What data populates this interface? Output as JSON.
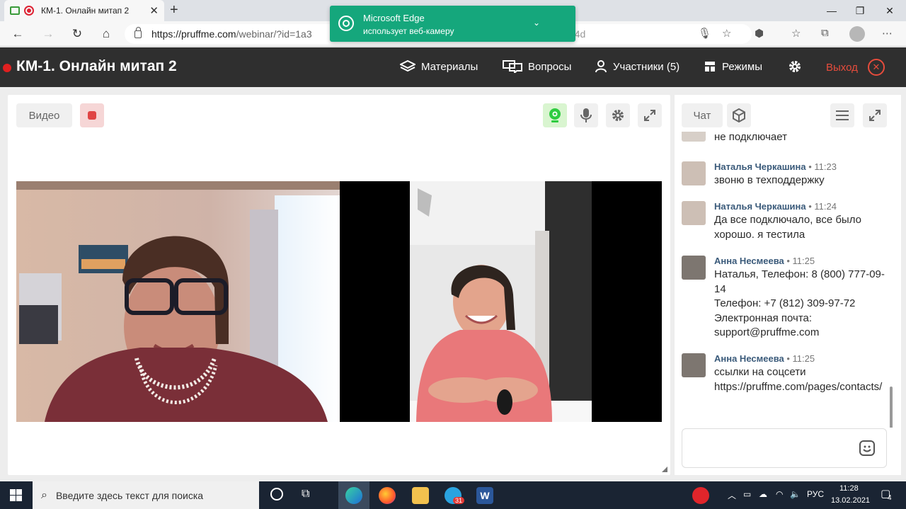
{
  "browser": {
    "tab_title": "КМ-1. Онлайн митап 2",
    "url_host": "https://pruffme.com",
    "url_rest": "/webinar/?id=1a3",
    "url_tail": "b7764d"
  },
  "notification": {
    "title": "Microsoft Edge",
    "text": "использует веб-камеру"
  },
  "header": {
    "title": "КМ-1. Онлайн митап 2",
    "menu": {
      "materials": "Материалы",
      "questions": "Вопросы",
      "participants": "Участники (5)",
      "modes": "Режимы",
      "exit": "Выход"
    }
  },
  "video": {
    "tab_label": "Видео"
  },
  "chat": {
    "tab_label": "Чат",
    "messages": [
      {
        "name": "",
        "time": "",
        "text": "не подключает"
      },
      {
        "name": "Наталья Черкашина",
        "time": " • 11:23",
        "text": "звоню в техподдержку"
      },
      {
        "name": "Наталья Черкашина",
        "time": " • 11:24",
        "text": "Да все подключало, все было хорошо. я тестила"
      },
      {
        "name": "Анна Несмеева",
        "time": " • 11:25",
        "text": "Наталья, Телефон: 8 (800) 777-09-14\nТелефон: +7 (812) 309-97-72\nЭлектронная почта:\nsupport@pruffme.com"
      },
      {
        "name": "Анна Несмеева",
        "time": " • 11:25",
        "text": "ссылки на соцсети",
        "link": "https://pruffme.com/pages/contacts/"
      }
    ]
  },
  "taskbar": {
    "search_placeholder": "Введите здесь текст для поиска",
    "lang": "РУС",
    "time": "11:28",
    "date": "13.02.2021",
    "telegram_badge": "31",
    "notif_count": "4"
  },
  "colors": {
    "header_bg": "#2f2f2f",
    "exit_red": "#e74c3c",
    "notif_green": "#15a77c",
    "active_cam_green": "#2ecc40",
    "author_blue": "#3a5a7a",
    "link_blue": "#2a7bbf"
  }
}
